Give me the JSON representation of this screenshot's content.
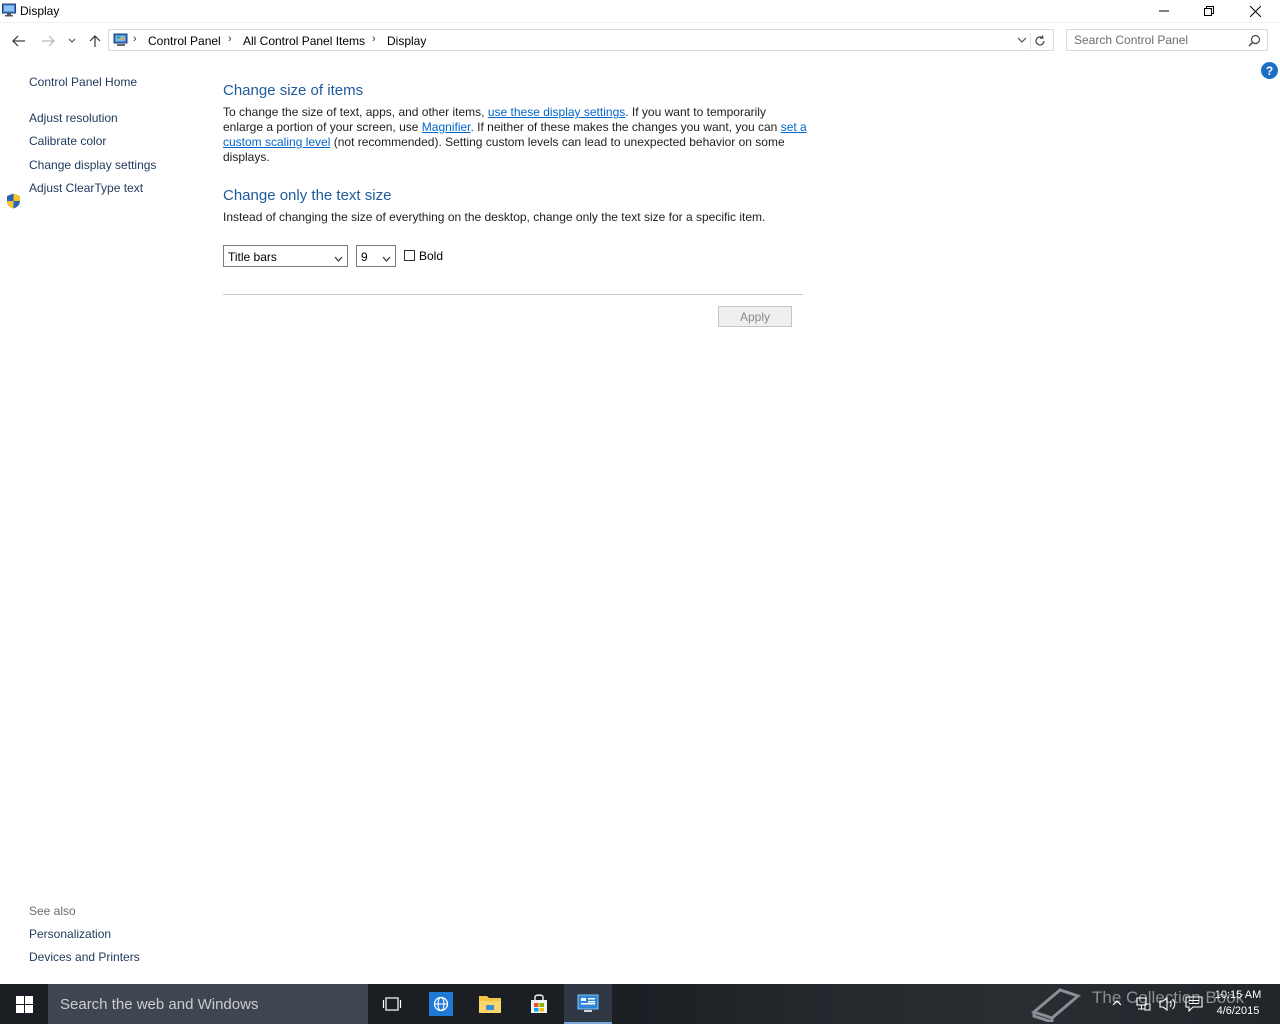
{
  "window": {
    "title": "Display"
  },
  "address_bar": {
    "crumbs": [
      "Control Panel",
      "All Control Panel Items",
      "Display"
    ]
  },
  "search": {
    "placeholder": "Search Control Panel"
  },
  "left_pane": {
    "home": "Control Panel Home",
    "links": [
      "Adjust resolution",
      "Calibrate color",
      "Change display settings",
      "Adjust ClearType text"
    ],
    "see_also_heading": "See also",
    "see_also": [
      "Personalization",
      "Devices and Printers"
    ]
  },
  "help": {
    "label": "?"
  },
  "main": {
    "size_heading": "Change size of items",
    "size_para": {
      "t1": "To change the size of text, apps, and other items, ",
      "link1": "use these display settings",
      "t2": ".  If you want to temporarily enlarge a portion of your screen, use ",
      "link2": "Magnifier",
      "t3": ".  If neither of these makes the changes you want, you can ",
      "link3": "set a custom scaling level",
      "t4": " (not recommended).  Setting custom levels can lead to unexpected behavior on some displays."
    },
    "text_heading": "Change only the text size",
    "text_para": "Instead of changing the size of everything on the desktop, change only the text size for a specific item.",
    "item_select": "Title bars",
    "size_select": "9",
    "bold_label": "Bold",
    "bold_checked": false,
    "apply_label": "Apply"
  },
  "taskbar": {
    "search_placeholder": "Search the web and Windows",
    "watermark": "The Collection Book",
    "time": "10:15 AM",
    "date": "4/6/2015"
  },
  "colors": {
    "link": "#1e395b",
    "heading": "#1e5a9c",
    "hyperlink": "#0066cc",
    "taskbar": "#1b1f24"
  }
}
